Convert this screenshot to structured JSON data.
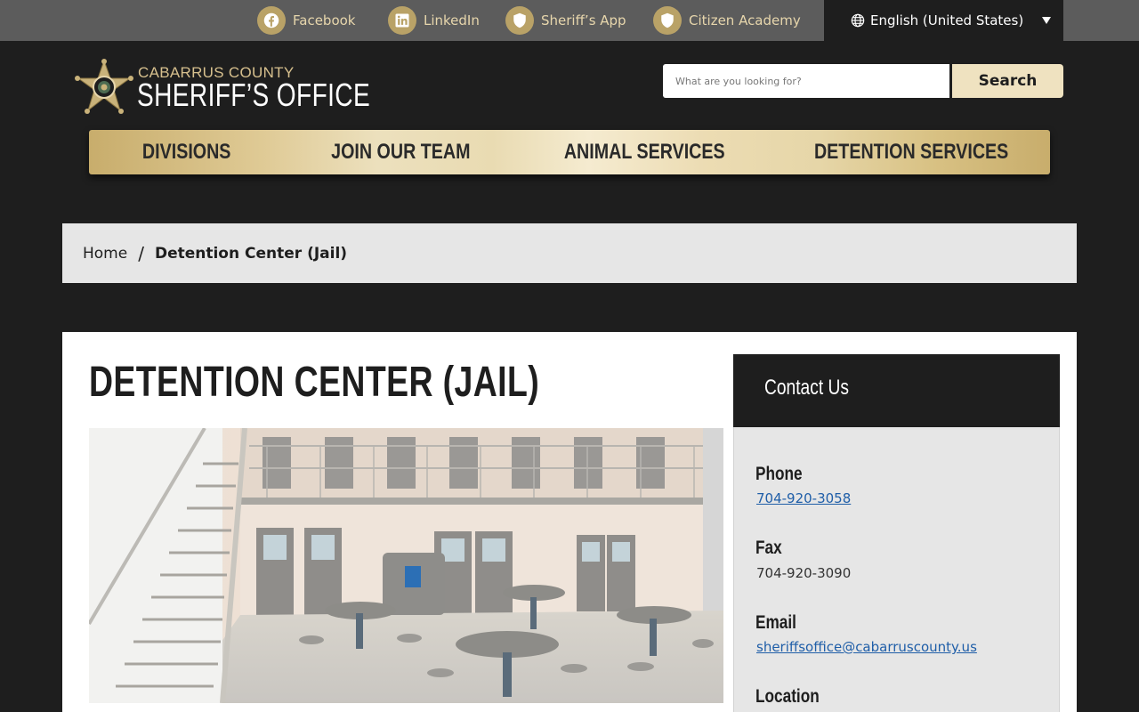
{
  "topbar": {
    "social": [
      {
        "label": "Facebook",
        "icon": "facebook-icon"
      },
      {
        "label": "LinkedIn",
        "icon": "linkedin-icon"
      },
      {
        "label": "Sheriff’s App",
        "icon": "shield-icon"
      },
      {
        "label": "Citizen Academy",
        "icon": "shield-icon"
      }
    ],
    "language": "English (United States)"
  },
  "header": {
    "logo_line1": "CABARRUS COUNTY",
    "logo_line2": "SHERIFF’S OFFICE",
    "search_placeholder": "What are you looking for?",
    "search_button": "Search"
  },
  "nav": {
    "items": [
      "DIVISIONS",
      "JOIN OUR TEAM",
      "ANIMAL SERVICES",
      "DETENTION SERVICES"
    ]
  },
  "breadcrumb": {
    "home": "Home",
    "separator": "/",
    "current": "Detention Center (Jail)"
  },
  "main": {
    "title": "DETENTION CENTER (JAIL)",
    "image": "jail-interior-photo"
  },
  "contact": {
    "heading": "Contact Us",
    "phone_label": "Phone",
    "phone": "704-920-3058",
    "fax_label": "Fax",
    "fax": "704-920-3090",
    "email_label": "Email",
    "email": "sheriffsoffice@cabarruscounty.us",
    "location_label": "Location"
  },
  "colors": {
    "gold": "#b9a267",
    "gold_text": "#e7d6ac",
    "dark": "#1e1e1e",
    "link": "#1f5ea8"
  }
}
